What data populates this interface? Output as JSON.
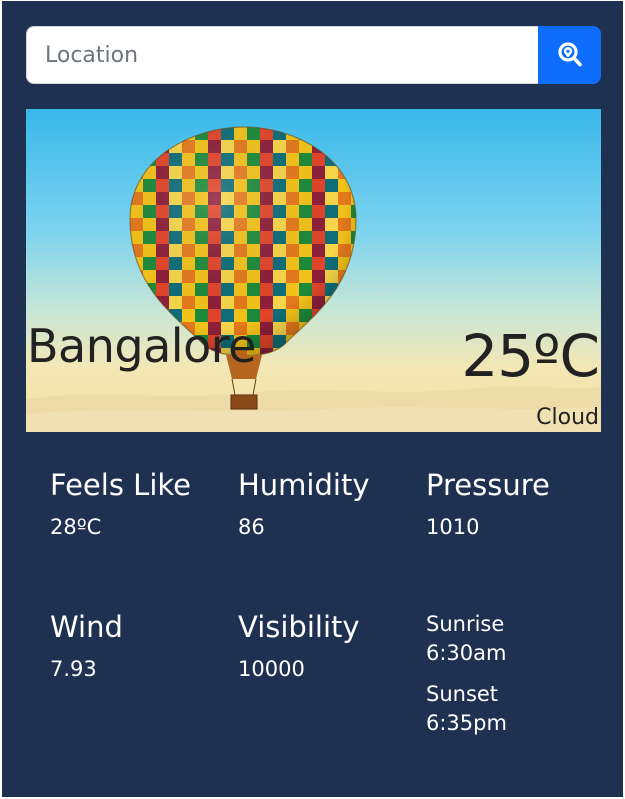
{
  "search": {
    "placeholder": "Location",
    "value": "",
    "button_icon": "location-search-icon"
  },
  "current": {
    "city": "Bangalore",
    "temperature": "25ºC",
    "condition": "Cloud"
  },
  "stats": {
    "feels_like": {
      "label": "Feels Like",
      "value": "28ºC"
    },
    "humidity": {
      "label": "Humidity",
      "value": "86"
    },
    "pressure": {
      "label": "Pressure",
      "value": "1010"
    },
    "wind": {
      "label": "Wind",
      "value": "7.93"
    },
    "visibility": {
      "label": "Visibility",
      "value": "10000"
    }
  },
  "sun": {
    "sunrise_label": "Sunrise",
    "sunrise_time": "6:30am",
    "sunset_label": "Sunset",
    "sunset_time": "6:35pm"
  },
  "colors": {
    "background": "#1e3150",
    "accent": "#0d6efd",
    "text": "#ffffff"
  }
}
